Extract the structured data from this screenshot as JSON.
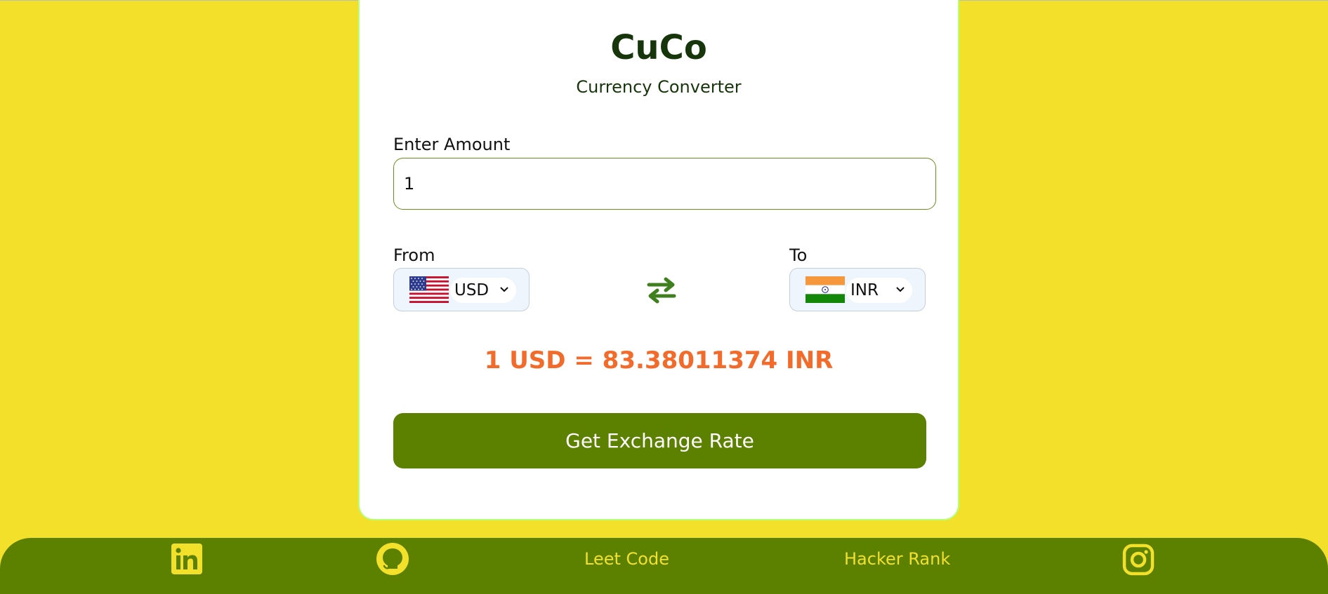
{
  "app": {
    "title": "CuCo",
    "subtitle": "Currency Converter"
  },
  "amount": {
    "label": "Enter Amount",
    "value": "1"
  },
  "from": {
    "label": "From",
    "currency": "USD",
    "flag_icon": "us-flag-icon"
  },
  "to": {
    "label": "To",
    "currency": "INR",
    "flag_icon": "india-flag-icon"
  },
  "swap_icon": "swap-arrows-icon",
  "result": {
    "text": "1 USD = 83.38011374 INR"
  },
  "button": {
    "label": "Get Exchange Rate"
  },
  "footer": {
    "links": [
      {
        "icon": "linkedin-icon"
      },
      {
        "icon": "github-icon"
      },
      {
        "label": "Leet Code"
      },
      {
        "label": "Hacker Rank"
      },
      {
        "icon": "instagram-icon"
      }
    ]
  },
  "colors": {
    "page_background": "#f2e02b",
    "accent_green": "#5c8100",
    "dark_green_text": "#17350b",
    "result_orange": "#f36b2a",
    "card_border": "#b5ff7a"
  }
}
